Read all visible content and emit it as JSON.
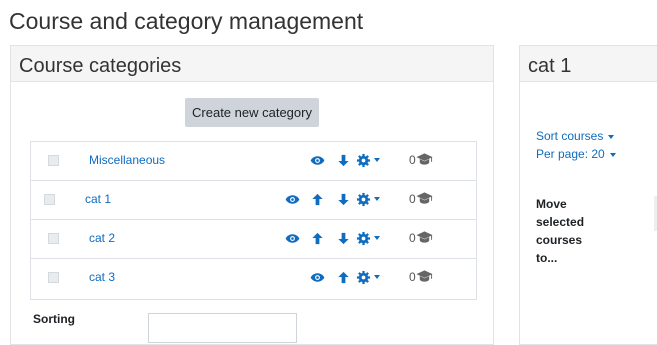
{
  "page": {
    "title": "Course and category management"
  },
  "categories_panel": {
    "heading": "Course categories",
    "create_button_label": "Create new category",
    "rows": [
      {
        "name": "Miscellaneous",
        "count": "0",
        "has_up": false,
        "has_down": true
      },
      {
        "name": "cat 1",
        "count": "0",
        "has_up": true,
        "has_down": true
      },
      {
        "name": "cat 2",
        "count": "0",
        "has_up": true,
        "has_down": true
      },
      {
        "name": "cat 3",
        "count": "0",
        "has_up": true,
        "has_down": false
      }
    ],
    "footer_label": "Sorting",
    "icons": [
      "eye-icon",
      "arrow-up-icon",
      "arrow-down-icon",
      "cog-icon",
      "graduation-cap-icon"
    ]
  },
  "courses_panel": {
    "heading": "cat 1",
    "sort_label": "Sort courses",
    "per_page_label": "Per page: 20",
    "move_label": "Move selected courses to..."
  },
  "colors": {
    "link": "#0f6cbf",
    "button_bg": "#ced4da",
    "header_bg": "#f5f5f5"
  }
}
